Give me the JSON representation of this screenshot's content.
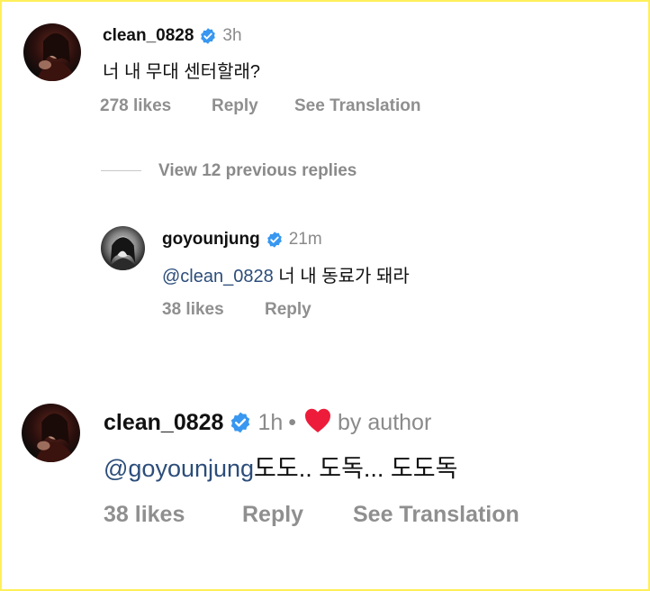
{
  "comments": [
    {
      "username": "clean_0828",
      "time": "3h",
      "text": "너 내 무대 센터할래?",
      "likes": "278 likes",
      "reply": "Reply",
      "translate": "See Translation",
      "verified_icon": "verified-badge-icon",
      "avatar": "profile-photo"
    }
  ],
  "view_replies": "View 12 previous replies",
  "replies": [
    {
      "username": "goyounjung",
      "time": "21m",
      "mention": "@clean_0828",
      "text": " 너 내 동료가 돼라",
      "likes": "38 likes",
      "reply": "Reply",
      "verified_icon": "verified-badge-icon",
      "avatar": "profile-photo-bw"
    }
  ],
  "comment2": {
    "username": "clean_0828",
    "time": "1h",
    "separator": "•",
    "liked_by_author_icon": "heart-icon",
    "by_author": "by author",
    "mention": "@goyounjung",
    "text": "도도.. 도독... 도도독",
    "likes": "38 likes",
    "reply": "Reply",
    "translate": "See Translation"
  },
  "colors": {
    "verified": "#3897f0",
    "heart": "#ed1c3a",
    "mention": "#2c4d7a",
    "muted": "#8a8a8a",
    "frame": "#ffef5a"
  }
}
